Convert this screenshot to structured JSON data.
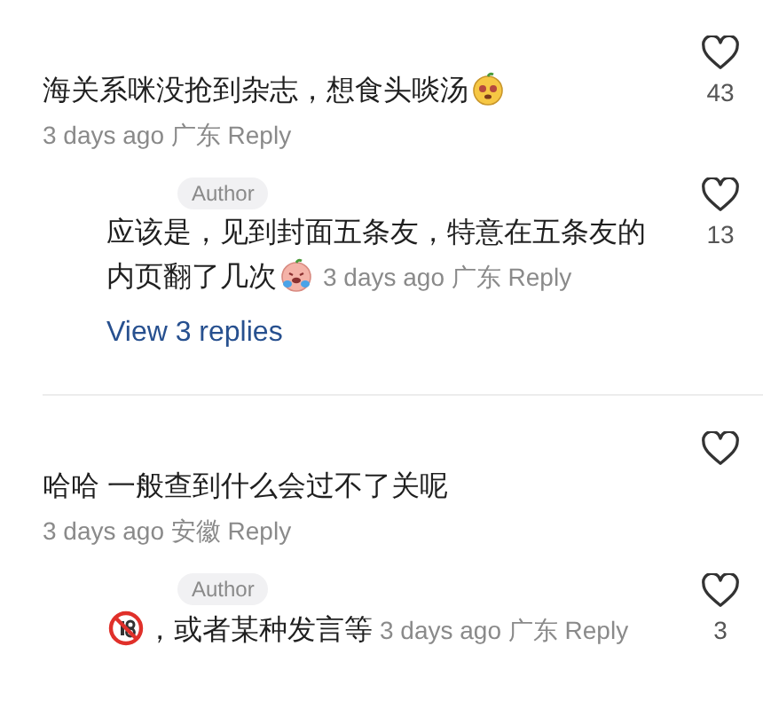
{
  "comments": [
    {
      "parts": [
        {
          "kind": "text",
          "text": "海关系咪没抢到杂志，想食头啖汤"
        },
        {
          "kind": "face"
        }
      ],
      "time": "3 days ago",
      "location": "广东",
      "reply_label": "Reply",
      "likes": "43",
      "replies": [
        {
          "badge": "Author",
          "parts": [
            {
              "kind": "line",
              "text": "应该是，见到封面五条友，特意在五条友的"
            },
            {
              "kind": "text",
              "text": "内页翻了几次"
            },
            {
              "kind": "crying-face"
            }
          ],
          "time": "3 days ago",
          "location": "广东",
          "reply_label": "Reply",
          "likes": "13"
        }
      ],
      "view_replies": "View 3 replies"
    },
    {
      "parts": [
        {
          "kind": "text",
          "text": "哈哈 一般查到什么会过不了关呢"
        }
      ],
      "time": "3 days ago",
      "location": "安徽",
      "reply_label": "Reply",
      "replies": [
        {
          "badge": "Author",
          "parts": [
            {
              "kind": "no-entry"
            },
            {
              "kind": "text",
              "text": "，或者某种发言等"
            }
          ],
          "time": "3 days ago",
          "location": "广东",
          "reply_label": "Reply",
          "likes": "3"
        }
      ]
    }
  ]
}
